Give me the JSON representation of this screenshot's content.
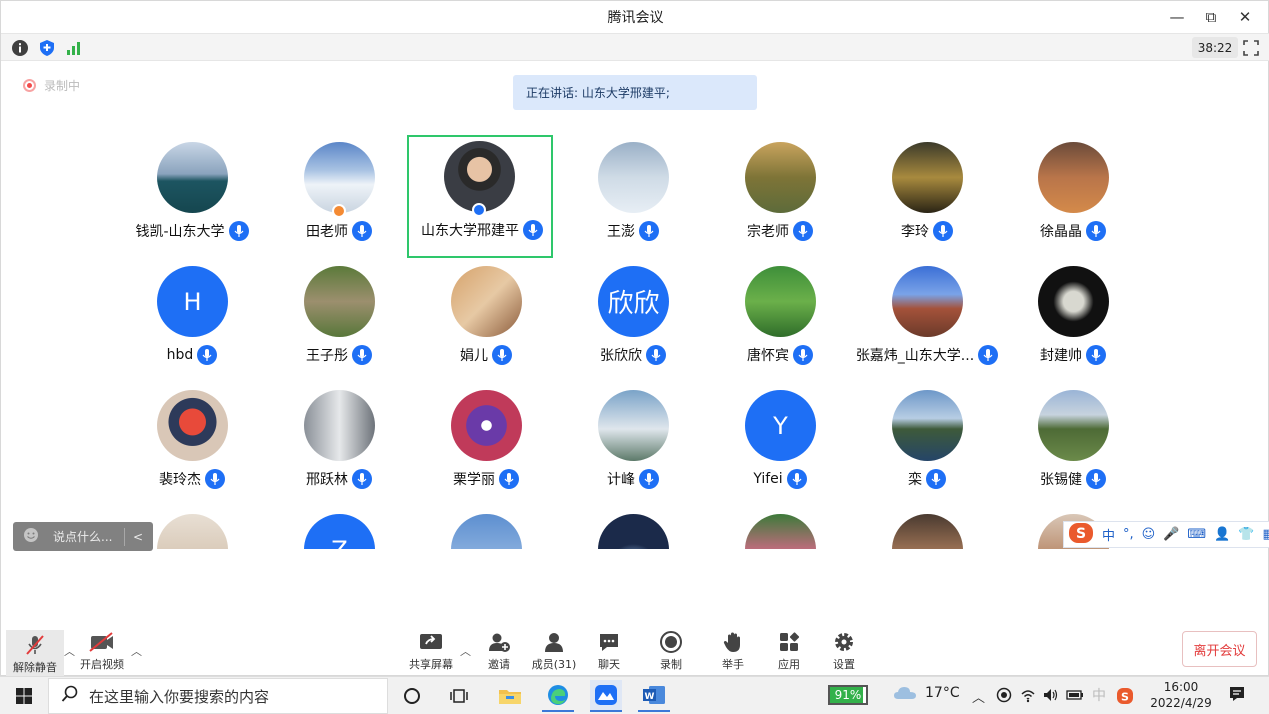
{
  "window": {
    "title": "腾讯会议",
    "controls": [
      "—",
      "⧉",
      "✕"
    ]
  },
  "topbar": {
    "timer": "38:22"
  },
  "recording": {
    "label": "录制中"
  },
  "speaking": {
    "text": "正在讲话: 山东大学邢建平;"
  },
  "participants": [
    {
      "name": "钱凯-山东大学",
      "avatar": "photo-lake",
      "mic": true
    },
    {
      "name": "田老师",
      "avatar": "photo-snow-mountain",
      "mic": true,
      "badge": "host"
    },
    {
      "name": "山东大学邢建平",
      "avatar": "photo-man-portrait",
      "mic": true,
      "badge": "cohost",
      "active": true
    },
    {
      "name": "王澎",
      "avatar": "photo-snow-field",
      "mic": true
    },
    {
      "name": "宗老师",
      "avatar": "photo-autumn-trees",
      "mic": true
    },
    {
      "name": "李玲",
      "avatar": "photo-sunset-tree",
      "mic": true
    },
    {
      "name": "徐晶晶",
      "avatar": "photo-building-stairs",
      "mic": true
    },
    {
      "name": "hbd",
      "avatar": "letter",
      "letter": "H",
      "mic": true
    },
    {
      "name": "王子彤",
      "avatar": "photo-garden",
      "mic": true
    },
    {
      "name": "娟儿",
      "avatar": "photo-cat",
      "mic": true
    },
    {
      "name": "张欣欣",
      "avatar": "letter",
      "letter": "欣欣",
      "mic": true
    },
    {
      "name": "唐怀宾",
      "avatar": "photo-green-leaves",
      "mic": true
    },
    {
      "name": "张嘉炜_山东大学...",
      "avatar": "photo-brick-building",
      "mic": true
    },
    {
      "name": "封建帅",
      "avatar": "photo-astronaut",
      "mic": true
    },
    {
      "name": "裴玲杰",
      "avatar": "photo-cartoon",
      "mic": true
    },
    {
      "name": "邢跃林",
      "avatar": "photo-skyscraper",
      "mic": true
    },
    {
      "name": "栗学丽",
      "avatar": "photo-flowers",
      "mic": true
    },
    {
      "name": "计峰",
      "avatar": "photo-clouds",
      "mic": true
    },
    {
      "name": "Yifei",
      "avatar": "letter",
      "letter": "Y",
      "mic": true
    },
    {
      "name": "栾",
      "avatar": "photo-river",
      "mic": true
    },
    {
      "name": "张锡健",
      "avatar": "photo-church-path",
      "mic": true
    },
    {
      "name": "",
      "avatar": "photo-sand",
      "mic": false
    },
    {
      "name": "",
      "avatar": "letter",
      "letter": "Z",
      "mic": false
    },
    {
      "name": "",
      "avatar": "photo-city-sky",
      "mic": false
    },
    {
      "name": "",
      "avatar": "photo-night-light",
      "mic": false
    },
    {
      "name": "",
      "avatar": "photo-pink-flower",
      "mic": false
    },
    {
      "name": "",
      "avatar": "photo-people",
      "mic": false
    },
    {
      "name": "",
      "avatar": "photo-flowers-2",
      "mic": false
    }
  ],
  "chat": {
    "placeholder": "说点什么...",
    "toggle": "<"
  },
  "ime": {
    "items": [
      "中",
      "°,",
      "☺",
      "🎤",
      "⌨",
      "👤",
      "👕",
      "▦"
    ]
  },
  "toolbar": {
    "unmute": "解除静音",
    "video": "开启视频",
    "share": "共享屏幕",
    "invite": "邀请",
    "members": "成员(31)",
    "chat": "聊天",
    "record": "录制",
    "raise_hand": "举手",
    "apps": "应用",
    "settings": "设置",
    "leave": "离开会议"
  },
  "taskbar": {
    "search_placeholder": "在这里输入你要搜索的内容",
    "battery": "91%",
    "battery_level": 0.91,
    "temperature": "17°C",
    "ime": "中",
    "time": "16:00",
    "date": "2022/4/29"
  }
}
